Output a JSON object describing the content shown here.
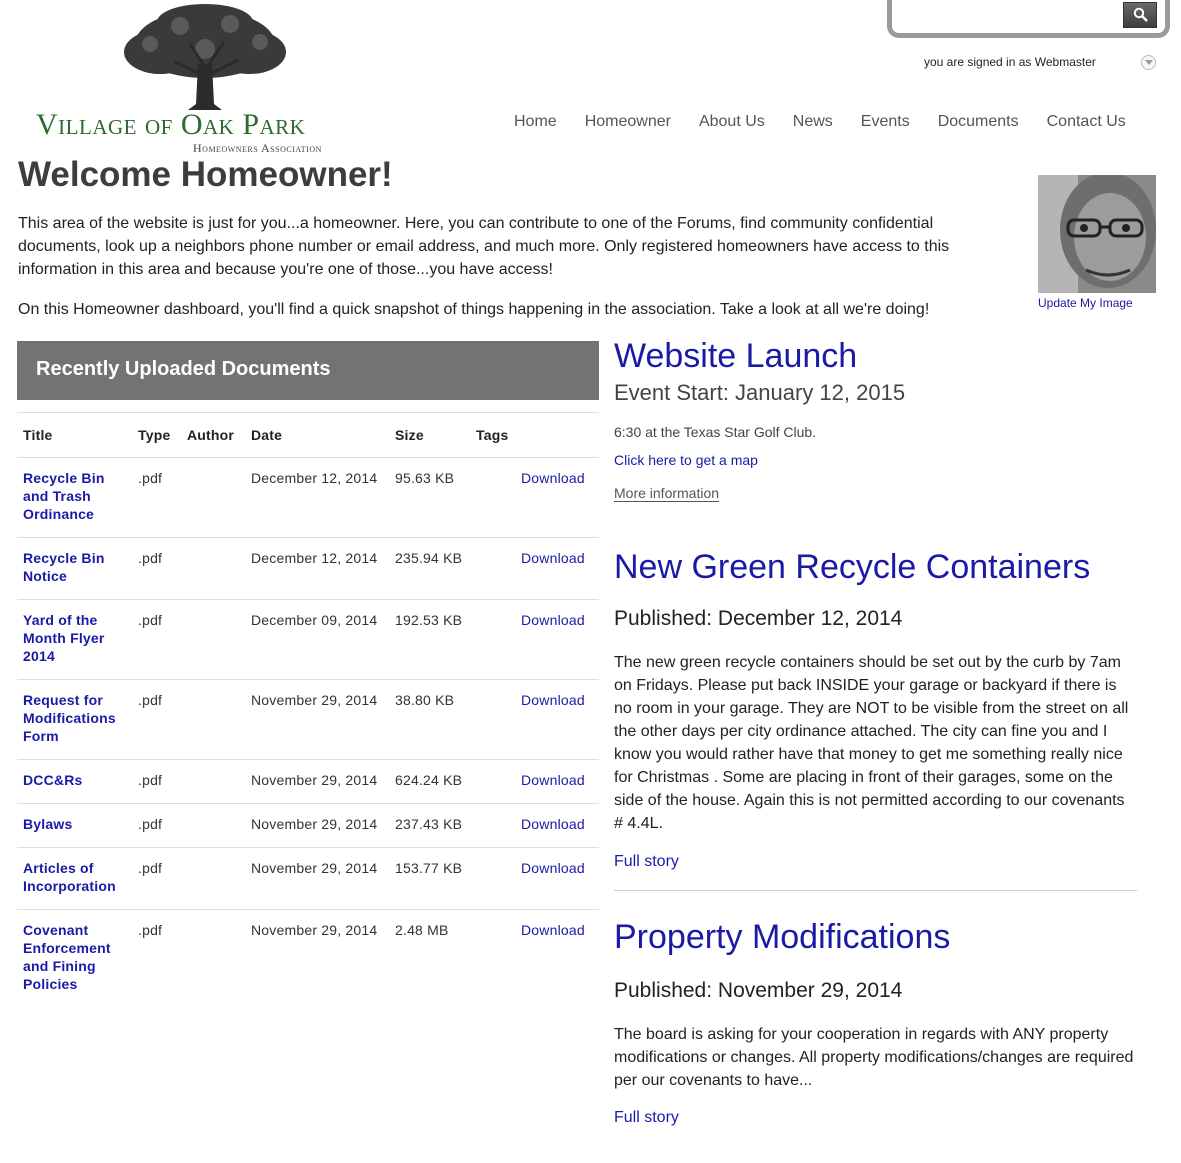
{
  "header": {
    "search": {
      "placeholder": ""
    },
    "signed_in_text": "you are signed in as Webmaster",
    "logo": {
      "name": "Village of Oak Park",
      "subtitle": "Homeowners Association"
    }
  },
  "nav": {
    "items": [
      {
        "label": "Home"
      },
      {
        "label": "Homeowner"
      },
      {
        "label": "About Us"
      },
      {
        "label": "News"
      },
      {
        "label": "Events"
      },
      {
        "label": "Documents"
      },
      {
        "label": "Contact Us"
      }
    ]
  },
  "page": {
    "title": "Welcome Homeowner!",
    "intro_paragraph": "This area of the website is just for you...a homeowner.  Here, you can contribute to one of the Forums, find community confidential documents, look up a neighbors phone number or email address, and much more.  Only registered homeowners have access to this information in this area and because you're one of those...you have access!",
    "dashboard_paragraph": "On this Homeowner dashboard, you'll find a quick snapshot of things happening in the association.  Take a look at all we're doing!",
    "update_image_label": "Update My Image"
  },
  "documents": {
    "header": "Recently Uploaded Documents",
    "columns": [
      "Title",
      "Type",
      "Author",
      "Date",
      "Size",
      "Tags",
      ""
    ],
    "download_label": "Download",
    "rows": [
      {
        "title": "Recycle Bin and Trash Ordinance",
        "type": ".pdf",
        "author": "",
        "date": "December 12, 2014",
        "size": "95.63 KB",
        "tags": ""
      },
      {
        "title": "Recycle Bin Notice",
        "type": ".pdf",
        "author": "",
        "date": "December 12, 2014",
        "size": "235.94 KB",
        "tags": ""
      },
      {
        "title": "Yard of the Month Flyer 2014",
        "type": ".pdf",
        "author": "",
        "date": "December 09, 2014",
        "size": "192.53 KB",
        "tags": ""
      },
      {
        "title": "Request for Modifications Form",
        "type": ".pdf",
        "author": "",
        "date": "November 29, 2014",
        "size": "38.80 KB",
        "tags": ""
      },
      {
        "title": "DCC&Rs",
        "type": ".pdf",
        "author": "",
        "date": "November 29, 2014",
        "size": "624.24 KB",
        "tags": ""
      },
      {
        "title": "Bylaws",
        "type": ".pdf",
        "author": "",
        "date": "November 29, 2014",
        "size": "237.43 KB",
        "tags": ""
      },
      {
        "title": "Articles of Incorporation",
        "type": ".pdf",
        "author": "",
        "date": "November 29, 2014",
        "size": "153.77 KB",
        "tags": ""
      },
      {
        "title": "Covenant Enforcement and Fining Policies",
        "type": ".pdf",
        "author": "",
        "date": "November 29, 2014",
        "size": "2.48 MB",
        "tags": ""
      }
    ]
  },
  "event": {
    "title": "Website Launch",
    "start": "Event Start: January 12, 2015",
    "description": "6:30 at the Texas Star Golf Club.",
    "map_link": "Click here to get a map",
    "more_link": "More information"
  },
  "news": [
    {
      "title": "New Green Recycle Containers",
      "published": "Published: December 12, 2014",
      "body": "The new green recycle containers should be set out by the curb by 7am on Fridays. Please put back INSIDE your garage or backyard if there is no room in your garage. They are NOT to be visible from the street on all the other days per city ordinance attached. The city can fine you and I know you would rather have that money to get me something really nice for Christmas . Some are placing in front of their garages, some on the side of the house. Again this is not permitted according to our covenants # 4.4L.",
      "link": "Full story"
    },
    {
      "title": "Property Modifications",
      "published": "Published: November 29, 2014",
      "body": "The board is asking for your cooperation in regards with ANY property modifications or changes. All property modifications/changes are required per our covenants to have...",
      "link": "Full story"
    }
  ]
}
